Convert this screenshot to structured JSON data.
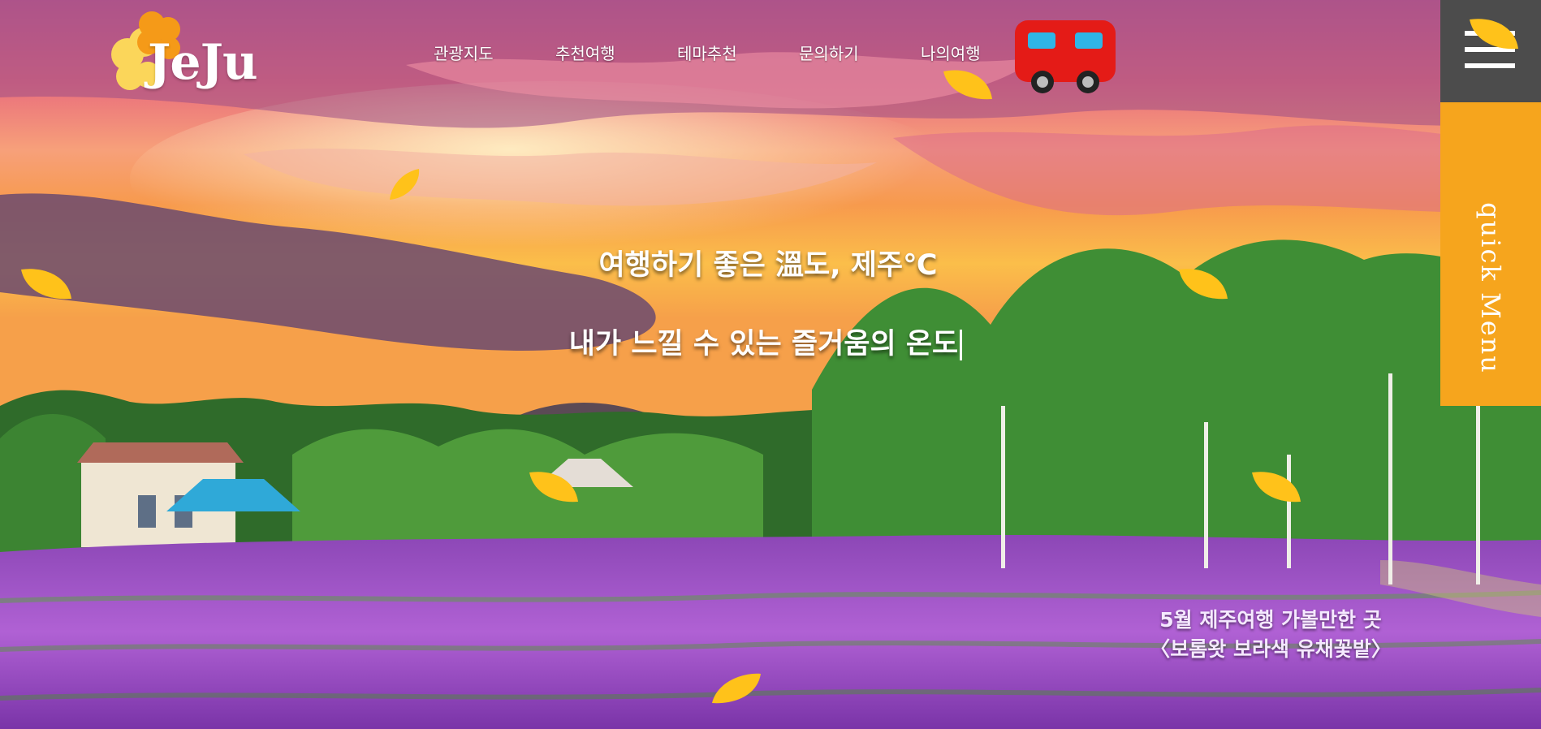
{
  "logo": {
    "text": "JeJu"
  },
  "nav": {
    "items": [
      {
        "label": "관광지도"
      },
      {
        "label": "추천여행"
      },
      {
        "label": "테마추천"
      },
      {
        "label": "문의하기"
      },
      {
        "label": "나의여행"
      }
    ]
  },
  "hero": {
    "headline_1": "여행하기 좋은 溫도, 제주℃",
    "headline_2": "내가 느낄 수 있는 즐거움의 온도"
  },
  "caption": {
    "line_1": "5월 제주여행 가볼만한 곳",
    "line_2": "〈보롬왓 보라색 유채꽃밭〉"
  },
  "quick_menu": {
    "label": "quick Menu"
  },
  "colors": {
    "quick_menu_accent": "#f6a51d",
    "quick_menu_header": "#4c4c4c",
    "bus_red": "#e41b17",
    "petal_yellow": "#ffc21a"
  },
  "icons": [
    "flower-logo-icon",
    "bus-icon",
    "hamburger-menu-icon",
    "petal-icon"
  ]
}
